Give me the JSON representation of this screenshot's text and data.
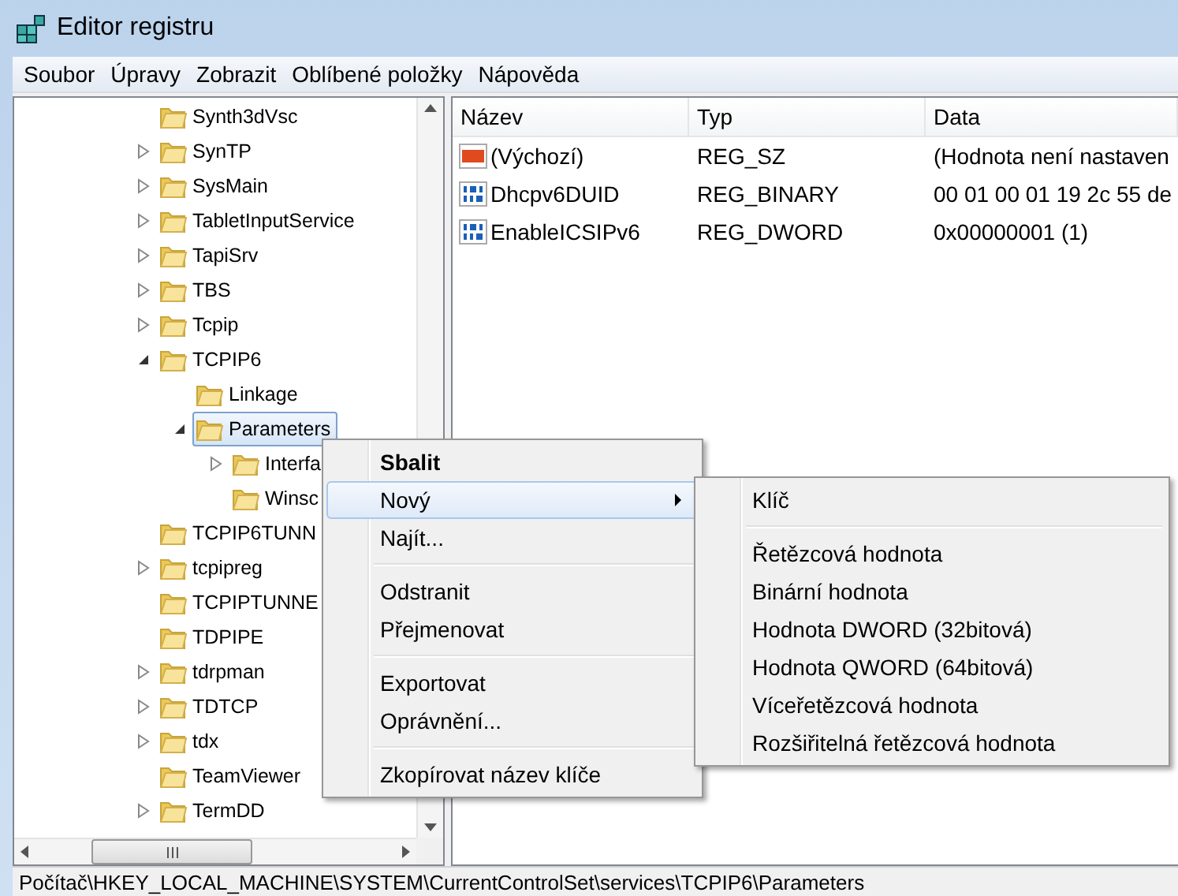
{
  "window": {
    "title": "Editor registru"
  },
  "menu_bar": [
    "Soubor",
    "Úpravy",
    "Zobrazit",
    "Oblíbené položky",
    "Nápověda"
  ],
  "tree": [
    {
      "label": "Synth3dVsc",
      "has_children": false,
      "selected": false
    },
    {
      "label": "SynTP",
      "has_children": true,
      "expanded": false,
      "selected": false
    },
    {
      "label": "SysMain",
      "has_children": true,
      "expanded": false,
      "selected": false
    },
    {
      "label": "TabletInputService",
      "has_children": true,
      "expanded": false,
      "selected": false
    },
    {
      "label": "TapiSrv",
      "has_children": true,
      "expanded": false,
      "selected": false
    },
    {
      "label": "TBS",
      "has_children": true,
      "expanded": false,
      "selected": false
    },
    {
      "label": "Tcpip",
      "has_children": true,
      "expanded": false,
      "selected": false
    },
    {
      "label": "TCPIP6",
      "has_children": true,
      "expanded": true,
      "selected": false,
      "children": [
        {
          "label": "Linkage",
          "has_children": false,
          "selected": false
        },
        {
          "label": "Parameters",
          "has_children": true,
          "expanded": true,
          "selected": true,
          "children": [
            {
              "label": "Interfa",
              "has_children": true,
              "expanded": false,
              "selected": false
            },
            {
              "label": "Winsc",
              "has_children": false,
              "selected": false
            }
          ]
        }
      ]
    },
    {
      "label": "TCPIP6TUNN",
      "has_children": false,
      "selected": false
    },
    {
      "label": "tcpipreg",
      "has_children": true,
      "expanded": false,
      "selected": false
    },
    {
      "label": "TCPIPTUNNE",
      "has_children": false,
      "selected": false
    },
    {
      "label": "TDPIPE",
      "has_children": false,
      "selected": false
    },
    {
      "label": "tdrpman",
      "has_children": true,
      "expanded": false,
      "selected": false
    },
    {
      "label": "TDTCP",
      "has_children": true,
      "expanded": false,
      "selected": false
    },
    {
      "label": "tdx",
      "has_children": true,
      "expanded": false,
      "selected": false
    },
    {
      "label": "TeamViewer",
      "has_children": false,
      "selected": false
    },
    {
      "label": "TermDD",
      "has_children": true,
      "expanded": false,
      "selected": false
    }
  ],
  "values": {
    "columns": [
      "Název",
      "Typ",
      "Data"
    ],
    "rows": [
      {
        "kind": "string",
        "name": "(Výchozí)",
        "type": "REG_SZ",
        "data": "(Hodnota není nastaven"
      },
      {
        "kind": "binary",
        "name": "Dhcpv6DUID",
        "type": "REG_BINARY",
        "data": "00 01 00 01 19 2c 55 de"
      },
      {
        "kind": "binary",
        "name": "EnableICSIPv6",
        "type": "REG_DWORD",
        "data": "0x00000001 (1)"
      }
    ]
  },
  "context_menu": {
    "groups": [
      [
        {
          "label": "Sbalit",
          "bold": true,
          "selected": false,
          "submenu": false
        },
        {
          "label": "Nový",
          "bold": false,
          "selected": true,
          "submenu": true
        },
        {
          "label": "Najít...",
          "bold": false,
          "selected": false,
          "submenu": false
        }
      ],
      [
        {
          "label": "Odstranit",
          "bold": false,
          "selected": false,
          "submenu": false
        },
        {
          "label": "Přejmenovat",
          "bold": false,
          "selected": false,
          "submenu": false
        }
      ],
      [
        {
          "label": "Exportovat",
          "bold": false,
          "selected": false,
          "submenu": false
        },
        {
          "label": "Oprávnění...",
          "bold": false,
          "selected": false,
          "submenu": false
        }
      ],
      [
        {
          "label": "Zkopírovat název klíče",
          "bold": false,
          "selected": false,
          "submenu": false
        }
      ]
    ]
  },
  "submenu": {
    "groups": [
      [
        "Klíč"
      ],
      [
        "Řetězcová hodnota",
        "Binární hodnota",
        "Hodnota DWORD (32bitová)",
        "Hodnota QWORD (64bitová)",
        "Víceřetězcová hodnota",
        "Rozšiřitelná řetězcová hodnota"
      ]
    ]
  },
  "status_bar": "Počítač\\HKEY_LOCAL_MACHINE\\SYSTEM\\CurrentControlSet\\services\\TCPIP6\\Parameters"
}
